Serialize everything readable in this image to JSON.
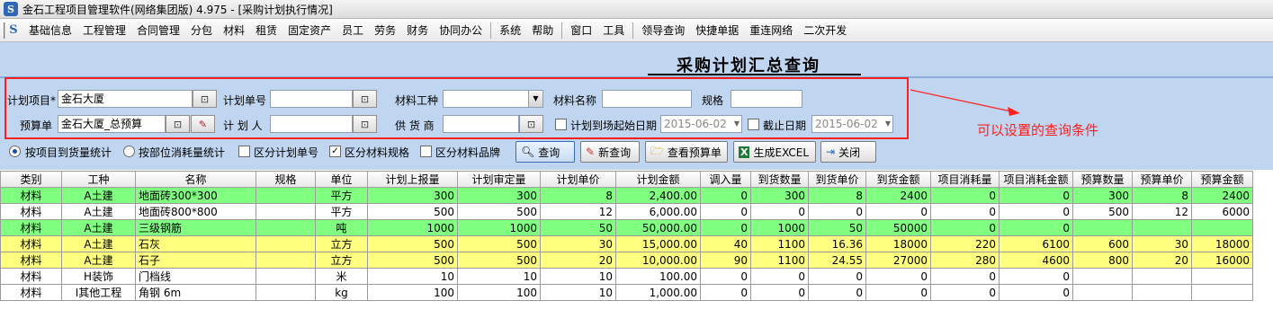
{
  "window": {
    "title": "金石工程项目管理软件(网络集团版) 4.975 - [采购计划执行情况]",
    "icon": "S"
  },
  "menu": [
    "基础信息",
    "工程管理",
    "合同管理",
    "分包",
    "材料",
    "租赁",
    "固定资产",
    "员工",
    "劳务",
    "财务",
    "协同办公",
    "系统",
    "帮助",
    "窗口",
    "工具",
    "领导查询",
    "快捷单据",
    "重连网络",
    "二次开发"
  ],
  "page_title": "采购计划汇总查询",
  "form": {
    "project_label": "计划项目*",
    "project_value": "金石大厦",
    "plan_no_label": "计划单号",
    "plan_no_value": "",
    "material_type_label": "材料工种",
    "material_type_value": "",
    "material_name_label": "材料名称",
    "material_name_value": "",
    "spec_label": "规格",
    "spec_value": "",
    "budget_label": "预算单",
    "budget_value": "金石大厦_总预算",
    "planner_label": "计 划 人",
    "planner_value": "",
    "supplier_label": "供 货 商",
    "supplier_value": "",
    "start_date_label": "计划到场起始日期",
    "start_date_value": "2015-06-02",
    "end_date_label": "截止日期",
    "end_date_value": "2015-06-02"
  },
  "options": {
    "radio1": "按项目到货量统计",
    "radio2": "按部位消耗量统计",
    "chk1": "区分计划单号",
    "chk2": "区分材料规格",
    "chk3": "区分材料品牌"
  },
  "buttons": {
    "query": "查询",
    "new_query": "新查询",
    "view_budget": "查看预算单",
    "excel": "生成EXCEL",
    "close": "关闭"
  },
  "annotation": "可以设置的查询条件",
  "colors": {
    "green_row": "#80ff80",
    "yellow_row": "#ffff80",
    "white_row": "#ffffff",
    "annotation": "#ff2020"
  },
  "table": {
    "headers": [
      "类别",
      "工种",
      "名称",
      "规格",
      "单位",
      "计划上报量",
      "计划审定量",
      "计划单价",
      "计划金额",
      "调入量",
      "到货数量",
      "到货单价",
      "到货金额",
      "项目消耗量",
      "项目消耗金额",
      "预算数量",
      "预算单价",
      "预算金额"
    ],
    "rows": [
      {
        "color": "green",
        "cells": [
          "材料",
          "A土建",
          "地面砖300*300",
          "",
          "平方",
          "300",
          "300",
          "8",
          "2,400.00",
          "0",
          "300",
          "8",
          "2400",
          "0",
          "0",
          "300",
          "8",
          "2400"
        ]
      },
      {
        "color": "white",
        "cells": [
          "材料",
          "A土建",
          "地面砖800*800",
          "",
          "平方",
          "500",
          "500",
          "12",
          "6,000.00",
          "0",
          "0",
          "0",
          "0",
          "0",
          "0",
          "500",
          "12",
          "6000"
        ]
      },
      {
        "color": "green",
        "cells": [
          "材料",
          "A土建",
          "三级钢筋",
          "",
          "吨",
          "1000",
          "1000",
          "50",
          "50,000.00",
          "0",
          "1000",
          "50",
          "50000",
          "0",
          "0",
          "",
          "",
          ""
        ]
      },
      {
        "color": "yellow",
        "cells": [
          "材料",
          "A土建",
          "石灰",
          "",
          "立方",
          "500",
          "500",
          "30",
          "15,000.00",
          "40",
          "1100",
          "16.36",
          "18000",
          "220",
          "6100",
          "600",
          "30",
          "18000"
        ]
      },
      {
        "color": "yellow",
        "cells": [
          "材料",
          "A土建",
          "石子",
          "",
          "立方",
          "500",
          "500",
          "20",
          "10,000.00",
          "90",
          "1100",
          "24.55",
          "27000",
          "280",
          "4600",
          "800",
          "20",
          "16000"
        ]
      },
      {
        "color": "white",
        "cells": [
          "材料",
          "H装饰",
          "门档线",
          "",
          "米",
          "10",
          "10",
          "10",
          "100.00",
          "0",
          "0",
          "0",
          "0",
          "0",
          "0",
          "",
          "",
          ""
        ]
      },
      {
        "color": "white",
        "cells": [
          "材料",
          "I其他工程",
          "角钢 6m",
          "",
          "kg",
          "100",
          "100",
          "10",
          "1,000.00",
          "0",
          "0",
          "0",
          "0",
          "0",
          "0",
          "",
          "",
          ""
        ]
      }
    ]
  }
}
